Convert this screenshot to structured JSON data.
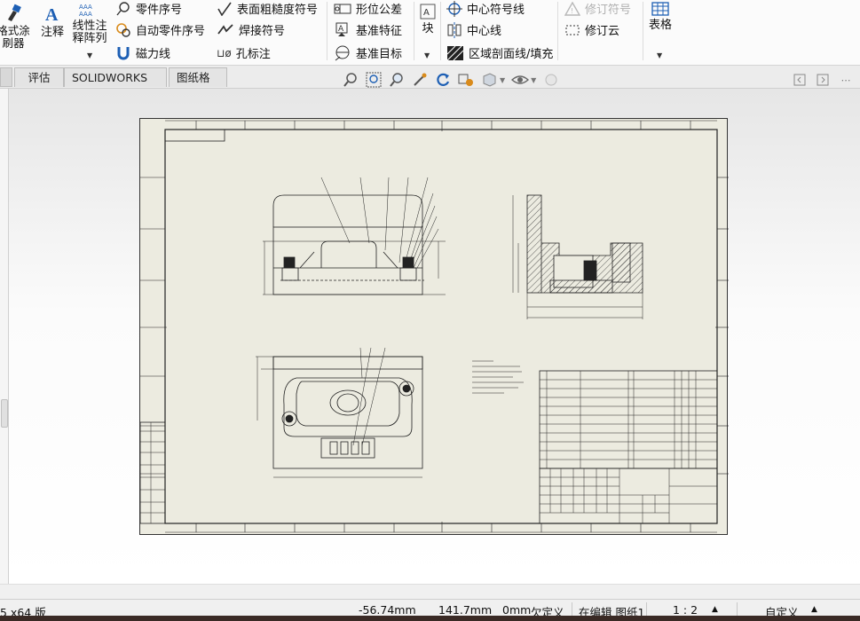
{
  "ribbon": {
    "format_painter": "格式涂\n刷器",
    "annotation": "注释",
    "linear_note": "线性注\n释阵列",
    "balloon": "零件序号",
    "auto_balloon": "自动零件序号",
    "magnetic_line": "磁力线",
    "surface_finish": "表面粗糙度符号",
    "weld_symbol": "焊接符号",
    "hole_callout": "孔标注",
    "hole_prefix": "⊔ø",
    "geometric_tolerance": "形位公差",
    "datum_feature": "基准特征",
    "datum_target": "基准目标",
    "block": "块",
    "center_mark": "中心符号线",
    "centerline": "中心线",
    "area_hatch": "区域剖面线/填充",
    "revision_symbol": "修订符号",
    "revision_cloud": "修订云",
    "table": "表格"
  },
  "tabs": [
    "评估",
    "SOLIDWORKS 插件",
    "图纸格式"
  ],
  "hud_icons": [
    "zoom-to-fit-icon",
    "zoom-to-area-icon",
    "zoom-in-out-icon",
    "pan-icon",
    "rotate-icon",
    "view-orientation-icon",
    "display-style-icon",
    "hide-show-icon",
    "appearance-icon"
  ],
  "status": {
    "version": "5 x64 版",
    "x": "-56.74mm",
    "y": "141.7mm",
    "z": "0mm",
    "definition": "欠定义",
    "editing": "在编辑 图纸1",
    "scale": "1 : 2",
    "units": "自定义"
  },
  "colors": {
    "sheet": "#ecebe0",
    "ribbon": "#fbfbfb",
    "accent_blue": "#1d5fb4",
    "icon_orange": "#d98b1c"
  }
}
